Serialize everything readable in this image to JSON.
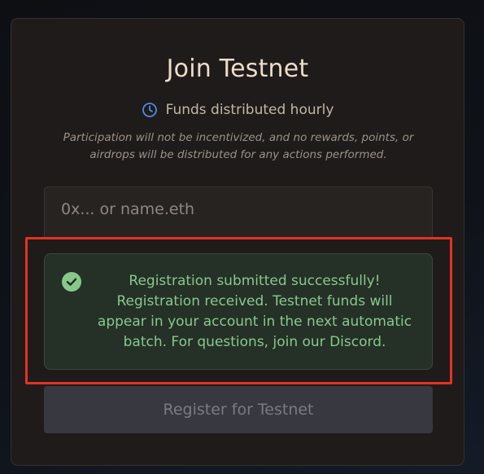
{
  "card": {
    "title": "Join Testnet",
    "schedule_text": "Funds distributed hourly",
    "schedule_icon": "clock-icon",
    "disclaimer": "Participation will not be incentivized, and no rewards, points, or airdrops will be distributed for any actions performed."
  },
  "address_input": {
    "value": "",
    "placeholder": "0x... or name.eth"
  },
  "success_message": {
    "icon": "check-circle-icon",
    "text": "Registration submitted successfully! Registration received. Testnet funds will appear in your account in the next automatic batch. For questions, join our Discord."
  },
  "register_button": {
    "label": "Register for Testnet",
    "disabled": true
  },
  "colors": {
    "accent_success": "#86c98b",
    "highlight_border": "#e63122",
    "clock_icon": "#4a8de0"
  }
}
